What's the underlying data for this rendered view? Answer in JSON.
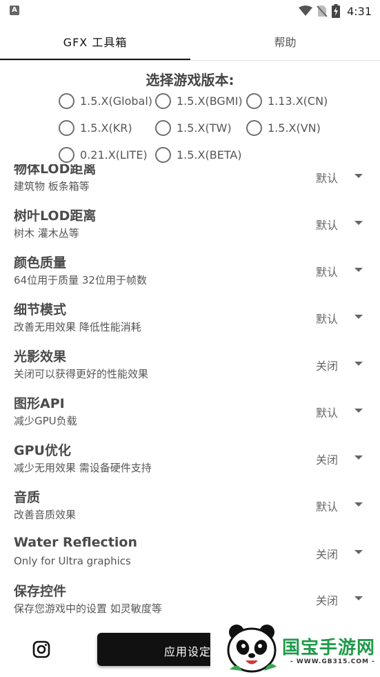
{
  "status_bar": {
    "app_icon_letter": "A",
    "time": "4:31",
    "icons": [
      "wifi-icon",
      "no-sim-icon",
      "battery-charging-icon"
    ]
  },
  "tabs": [
    {
      "label": "GFX 工具箱",
      "selected": true
    },
    {
      "label": "帮助",
      "selected": false
    }
  ],
  "version_select": {
    "title": "选择游戏版本:",
    "options": [
      {
        "label": "1.5.X(Global)",
        "checked": false
      },
      {
        "label": "1.5.X(BGMI)",
        "checked": false
      },
      {
        "label": "1.13.X(CN)",
        "checked": false
      },
      {
        "label": "1.5.X(KR)",
        "checked": false
      },
      {
        "label": "1.5.X(TW)",
        "checked": false
      },
      {
        "label": "1.5.X(VN)",
        "checked": false
      },
      {
        "label": "0.21.X(LITE)",
        "checked": false
      },
      {
        "label": "1.5.X(BETA)",
        "checked": false
      }
    ]
  },
  "settings": [
    {
      "title": "物体LOD距离",
      "desc": "建筑物 板条箱等",
      "value": "默认"
    },
    {
      "title": "树叶LOD距离",
      "desc": "树木 灌木丛等",
      "value": "默认"
    },
    {
      "title": "颜色质量",
      "desc": "64位用于质量 32位用于帧数",
      "value": "默认"
    },
    {
      "title": "细节模式",
      "desc": "改善无用效果 降低性能消耗",
      "value": "默认"
    },
    {
      "title": "光影效果",
      "desc": "关闭可以获得更好的性能效果",
      "value": "关闭"
    },
    {
      "title": "图形API",
      "desc": "减少GPU负载",
      "value": "默认"
    },
    {
      "title": "GPU优化",
      "desc": "减少无用效果 需设备硬件支持",
      "value": "关闭"
    },
    {
      "title": "音质",
      "desc": "改善音质效果",
      "value": "默认"
    },
    {
      "title": "Water Reflection",
      "desc": "Only for Ultra graphics",
      "value": "关闭"
    },
    {
      "title": "保存控件",
      "desc": "保存您游戏中的设置 如灵敏度等",
      "value": "关闭"
    }
  ],
  "bottom": {
    "apply_label": "应用设定"
  },
  "watermark": {
    "brand": "国宝手游网",
    "url": "- WWW.GB315.COM -"
  }
}
